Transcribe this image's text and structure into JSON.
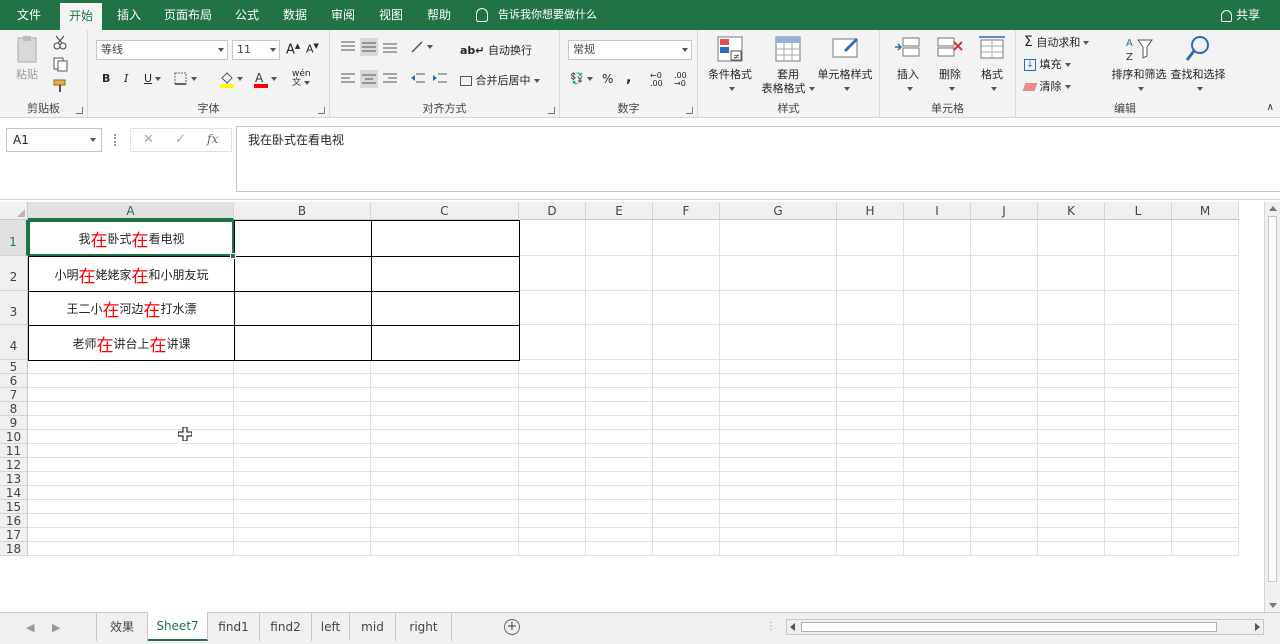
{
  "tabs": [
    "文件",
    "开始",
    "插入",
    "页面布局",
    "公式",
    "数据",
    "审阅",
    "视图",
    "帮助"
  ],
  "tell_me": "告诉我你想要做什么",
  "share": "共享",
  "clipboard": {
    "paste": "粘贴",
    "label": "剪贴板"
  },
  "font": {
    "name": "等线",
    "size": "11",
    "label": "字体",
    "phonetic": "wén"
  },
  "alignment": {
    "wrap": "自动换行",
    "merge": "合并后居中",
    "label": "对齐方式"
  },
  "number": {
    "format": "常规",
    "label": "数字"
  },
  "styles": {
    "conditional": "条件格式",
    "table_l1": "套用",
    "table_l2": "表格格式",
    "cell_styles": "单元格样式",
    "label": "样式"
  },
  "cells": {
    "insert": "插入",
    "delete": "删除",
    "format": "格式",
    "label": "单元格"
  },
  "editing": {
    "autosum": "自动求和",
    "fill": "填充",
    "clear": "清除",
    "sort": "排序和筛选",
    "find": "查找和选择",
    "label": "编辑"
  },
  "formula_bar": {
    "name_box": "A1",
    "fx": "fx",
    "content": "我在卧式在看电视"
  },
  "columns": [
    "A",
    "B",
    "C",
    "D",
    "E",
    "F",
    "G",
    "H",
    "I",
    "J",
    "K",
    "L",
    "M"
  ],
  "rows": [
    "1",
    "2",
    "3",
    "4",
    "5",
    "6",
    "7",
    "8",
    "9",
    "10",
    "11",
    "12",
    "13",
    "14",
    "15",
    "16",
    "17",
    "18"
  ],
  "cells_data": [
    [
      {
        "t": "我"
      },
      {
        "t": "在",
        "h": true
      },
      {
        "t": "卧式"
      },
      {
        "t": "在",
        "h": true
      },
      {
        "t": "看电视"
      }
    ],
    [
      {
        "t": "小明"
      },
      {
        "t": "在",
        "h": true
      },
      {
        "t": "姥姥家"
      },
      {
        "t": "在",
        "h": true
      },
      {
        "t": "和小朋友玩"
      }
    ],
    [
      {
        "t": "王二小"
      },
      {
        "t": "在",
        "h": true
      },
      {
        "t": "河边"
      },
      {
        "t": "在",
        "h": true
      },
      {
        "t": "打水漂"
      }
    ],
    [
      {
        "t": "老师"
      },
      {
        "t": "在",
        "h": true
      },
      {
        "t": "讲台上"
      },
      {
        "t": "在",
        "h": true
      },
      {
        "t": "讲课"
      }
    ]
  ],
  "sheets": [
    "效果",
    "Sheet7",
    "find1",
    "find2",
    "left",
    "mid",
    "right"
  ],
  "active_sheet": "Sheet7",
  "colors": {
    "accent": "#217346",
    "highlight": "#ff0000"
  }
}
